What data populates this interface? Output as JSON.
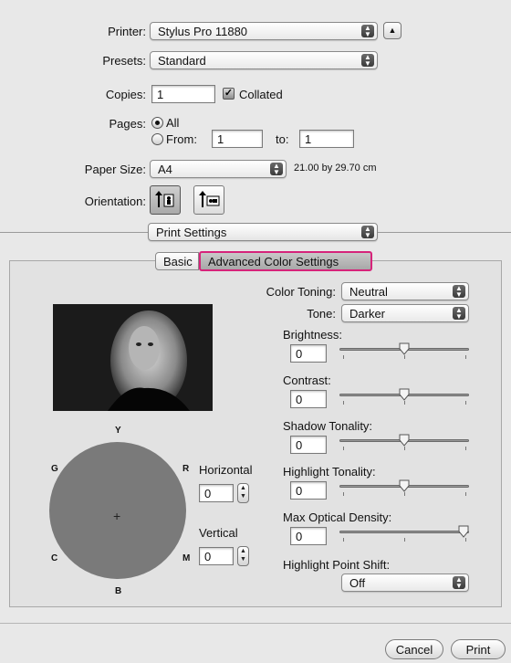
{
  "printer": {
    "label": "Printer:",
    "value": "Stylus Pro 11880"
  },
  "presets": {
    "label": "Presets:",
    "value": "Standard"
  },
  "copies": {
    "label": "Copies:",
    "value": "1",
    "collated_label": "Collated",
    "collated_checked": true
  },
  "pages": {
    "label": "Pages:",
    "all_label": "All",
    "from_label": "From:",
    "from_value": "1",
    "to_label": "to:",
    "to_value": "1",
    "selected": "All"
  },
  "paper_size": {
    "label": "Paper Size:",
    "value": "A4",
    "dimensions": "21.00 by 29.70 cm"
  },
  "orientation": {
    "label": "Orientation:",
    "selected": "portrait"
  },
  "panel_popup": {
    "value": "Print Settings"
  },
  "tabs": [
    {
      "label": "Basic"
    },
    {
      "label": "Advanced Color Settings",
      "selected": true,
      "highlight": "#d6237a"
    }
  ],
  "color_toning": {
    "label": "Color Toning:",
    "value": "Neutral"
  },
  "tone": {
    "label": "Tone:",
    "value": "Darker"
  },
  "sliders": [
    {
      "label": "Brightness:",
      "value": "0",
      "level": 0.5
    },
    {
      "label": "Contrast:",
      "value": "0",
      "level": 0.5
    },
    {
      "label": "Shadow Tonality:",
      "value": "0",
      "level": 0.5
    },
    {
      "label": "Highlight Tonality:",
      "value": "0",
      "level": 0.5
    },
    {
      "label": "Max Optical Density:",
      "value": "0",
      "level": 1.0
    }
  ],
  "highlight_point_shift": {
    "label": "Highlight Point Shift:",
    "value": "Off"
  },
  "color_wheel": {
    "labels": {
      "y": "Y",
      "r": "R",
      "m": "M",
      "b": "B",
      "c": "C",
      "g": "G"
    },
    "color": "#7a7a7a"
  },
  "horizontal": {
    "label": "Horizontal",
    "value": "0"
  },
  "vertical": {
    "label": "Vertical",
    "value": "0"
  },
  "buttons": {
    "cancel": "Cancel",
    "print": "Print"
  }
}
